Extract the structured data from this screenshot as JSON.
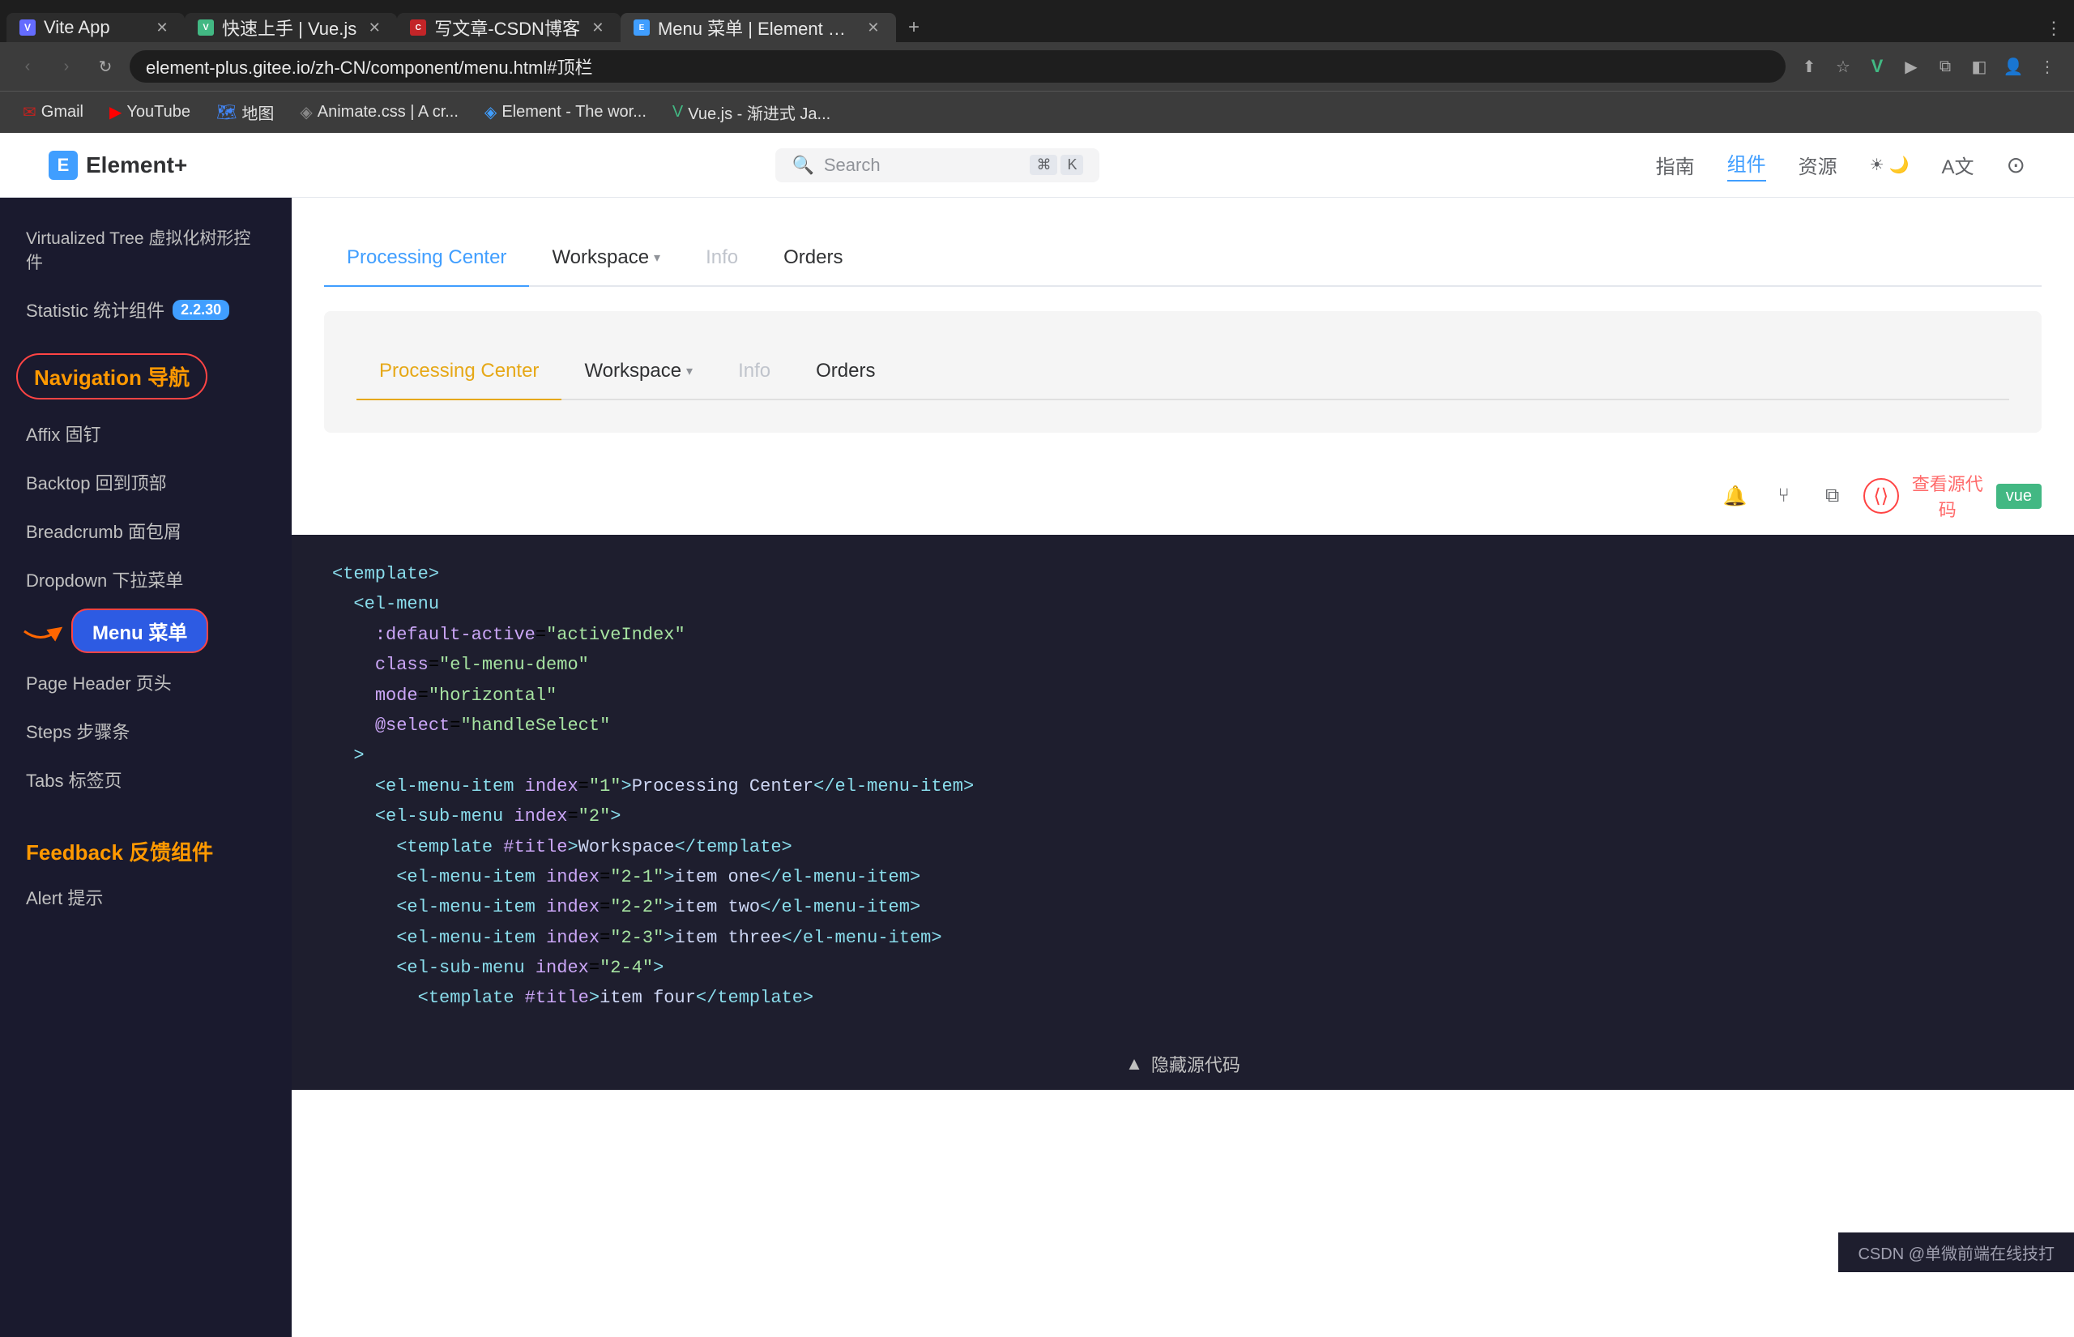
{
  "browser": {
    "tabs": [
      {
        "id": "vite",
        "favicon_type": "vite",
        "label": "Vite App",
        "active": false
      },
      {
        "id": "vuejs",
        "favicon_type": "vue",
        "label": "快速上手 | Vue.js",
        "active": false
      },
      {
        "id": "csdn",
        "favicon_type": "csdn",
        "label": "写文章-CSDN博客",
        "active": false
      },
      {
        "id": "element",
        "favicon_type": "element",
        "label": "Menu 菜单 | Element Plus",
        "active": true
      }
    ],
    "address": "element-plus.gitee.io/zh-CN/component/menu.html#顶栏",
    "bookmarks": [
      {
        "id": "gmail",
        "label": "Gmail",
        "color": "#c5221f"
      },
      {
        "id": "youtube",
        "label": "YouTube",
        "color": "#ff0000"
      },
      {
        "id": "maps",
        "label": "地图",
        "color": "#4285f4"
      },
      {
        "id": "animate",
        "label": "Animate.css | A cr...",
        "color": "#888"
      },
      {
        "id": "element-bm",
        "label": "Element - The wor...",
        "color": "#409eff"
      },
      {
        "id": "vuejs-bm",
        "label": "Vue.js - 渐进式 Ja...",
        "color": "#42b883"
      }
    ]
  },
  "site_header": {
    "logo": "Element+",
    "search_placeholder": "Search",
    "search_shortcut": "⌘ K",
    "nav_items": [
      "指南",
      "组件",
      "资源"
    ],
    "active_nav": "组件"
  },
  "sidebar": {
    "items_above": [
      {
        "id": "virtualized-tree",
        "label": "Virtualized Tree 虚拟化树形控件"
      },
      {
        "id": "statistic",
        "label": "Statistic 统计组件",
        "badge": "2.2.30"
      }
    ],
    "section_navigation": "Navigation 导航",
    "navigation_items": [
      {
        "id": "affix",
        "label": "Affix 固钉"
      },
      {
        "id": "backtop",
        "label": "Backtop 回到顶部"
      },
      {
        "id": "breadcrumb",
        "label": "Breadcrumb 面包屑"
      },
      {
        "id": "dropdown",
        "label": "Dropdown 下拉菜单"
      },
      {
        "id": "menu",
        "label": "Menu 菜单",
        "active": true
      },
      {
        "id": "page-header",
        "label": "Page Header 页头"
      },
      {
        "id": "steps",
        "label": "Steps 步骤条"
      },
      {
        "id": "tabs",
        "label": "Tabs 标签页"
      }
    ],
    "section_feedback": "Feedback 反馈组件",
    "feedback_items": [
      {
        "id": "alert",
        "label": "Alert 提示"
      }
    ]
  },
  "demo1": {
    "menu_items": [
      {
        "id": "processing-center",
        "label": "Processing Center",
        "active": true
      },
      {
        "id": "workspace",
        "label": "Workspace",
        "has_arrow": true
      },
      {
        "id": "info",
        "label": "Info",
        "disabled": true
      },
      {
        "id": "orders",
        "label": "Orders"
      }
    ]
  },
  "demo2": {
    "menu_items": [
      {
        "id": "processing-center2",
        "label": "Processing Center",
        "active": true
      },
      {
        "id": "workspace2",
        "label": "Workspace",
        "has_arrow": true
      },
      {
        "id": "info2",
        "label": "Info",
        "disabled": true
      },
      {
        "id": "orders2",
        "label": "Orders"
      }
    ]
  },
  "code": {
    "view_source_label": "查看源代\n码",
    "vue_label": "vue",
    "lines": [
      {
        "indent": 0,
        "content": "<template>",
        "type": "tag"
      },
      {
        "indent": 1,
        "content": "<el-menu",
        "type": "tag"
      },
      {
        "indent": 2,
        "content": ":default-active=\"activeIndex\"",
        "type": "attr"
      },
      {
        "indent": 2,
        "content": "class=\"el-menu-demo\"",
        "type": "attr"
      },
      {
        "indent": 2,
        "content": "mode=\"horizontal\"",
        "type": "attr"
      },
      {
        "indent": 2,
        "content": "@select=\"handleSelect\"",
        "type": "attr"
      },
      {
        "indent": 1,
        "content": ">",
        "type": "tag"
      },
      {
        "indent": 2,
        "content": "<el-menu-item index=\"1\">Processing Center</el-menu-item>",
        "type": "mixed"
      },
      {
        "indent": 2,
        "content": "<el-sub-menu index=\"2\">",
        "type": "tag"
      },
      {
        "indent": 3,
        "content": "<template #title>Workspace</template>",
        "type": "mixed"
      },
      {
        "indent": 3,
        "content": "<el-menu-item index=\"2-1\">item one</el-menu-item>",
        "type": "mixed"
      },
      {
        "indent": 3,
        "content": "<el-menu-item index=\"2-2\">item two</el-menu-item>",
        "type": "mixed"
      },
      {
        "indent": 3,
        "content": "<el-menu-item index=\"2-3\">item three</el-menu-item>",
        "type": "mixed"
      },
      {
        "indent": 3,
        "content": "<el-sub-menu index=\"2-4\">",
        "type": "tag"
      },
      {
        "indent": 4,
        "content": "<template #title>item four</template>",
        "type": "mixed"
      }
    ]
  },
  "footer": {
    "hide_code_label": "▲ 隐藏源代码",
    "csdn_label": "CSDN @单微前端在线技打"
  },
  "colors": {
    "active_blue": "#409eff",
    "active_yellow": "#e6a817",
    "sidebar_bg": "#1a1a2e",
    "code_bg": "#1e1e2e",
    "highlight_red": "#ff4444"
  }
}
